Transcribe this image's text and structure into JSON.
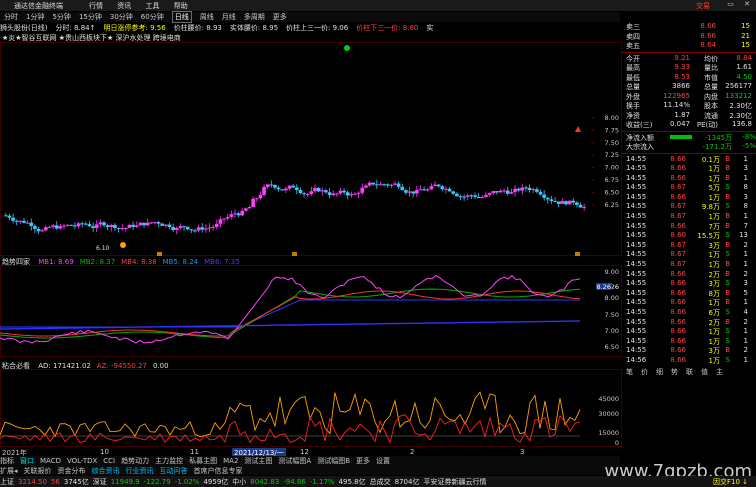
{
  "titlebar": {
    "app_name": "通达信金融终端",
    "menu": [
      "行情",
      "资讯",
      "工具",
      "帮助"
    ],
    "brand": "交易",
    "window_controls": "▭ ✕"
  },
  "periodbar": {
    "items": [
      "分时",
      "1分钟",
      "5分钟",
      "15分钟",
      "30分钟",
      "60分钟",
      "日线",
      "周线",
      "月线",
      "多周期",
      "更多"
    ],
    "active": "日线"
  },
  "infoline": {
    "items": [
      {
        "text": "狮头股份(日线)",
        "color": "#e0e0e0"
      },
      {
        "text": "分时: 8.84↑",
        "color": "#e0e0e0"
      },
      {
        "text": "明日涨停参考: 9.56",
        "color": "#ffff00"
      },
      {
        "text": "价柱腰价: 8.93",
        "color": "#e0e0e0"
      },
      {
        "text": "实体腰价: 8.95",
        "color": "#e0e0e0"
      },
      {
        "text": "价柱上三一价: 9.06",
        "color": "#e0e0e0"
      },
      {
        "text": "价柱下三一价: 8.80",
        "color": "#ff4040"
      },
      {
        "text": "实",
        "color": "#e0e0e0"
      }
    ],
    "sub": "★炎★智谷互联网 ★贵山西板块下★ 深沪水处理 跨境电商"
  },
  "main_chart": {
    "y_ticks": [
      "8.00",
      "7.75",
      "7.50",
      "7.25",
      "7.00",
      "6.75",
      "6.50",
      "6.25"
    ],
    "low_label": "6.10",
    "up_color": "#ff3cff",
    "down_color": "#3cc8ff"
  },
  "indicator1": {
    "name": "趋势四家",
    "labels": [
      {
        "text": "MB1: 8.69",
        "color": "#ff40ff"
      },
      {
        "text": "MB2: 8.37",
        "color": "#00c000"
      },
      {
        "text": "MB4: 8.38",
        "color": "#ff4040"
      },
      {
        "text": "MB5: 8.24",
        "color": "#00a0ff"
      },
      {
        "text": "MB6: 7.35",
        "color": "#4040ff"
      }
    ],
    "y_ticks": [
      "9.00",
      "8.26",
      "8.00",
      "7.50",
      "7.00",
      "6.50"
    ],
    "marker": "8.26"
  },
  "indicator2": {
    "name": "粘合必看",
    "labels": [
      {
        "text": "AD: 171421.02",
        "color": "#e0e0e0"
      },
      {
        "text": "AZ: -94550.27",
        "color": "#ff4040"
      },
      {
        "text": "0.00",
        "color": "#e0e0e0"
      }
    ],
    "y_ticks": [
      "45000",
      "30000",
      "15000",
      "0"
    ]
  },
  "timeaxis": {
    "labels": [
      "2021年",
      "10",
      "11",
      "12",
      "2021/12/13/一",
      "2",
      "3"
    ]
  },
  "tabsbar": {
    "items": [
      "指标",
      "窗口",
      "MACD",
      "VOL-TDX",
      "CCI",
      "趋势动力",
      "主力监控",
      "私募主图",
      "MA2",
      "测试主图",
      "测试幅图A",
      "测试幅图B",
      "更多",
      "设置"
    ]
  },
  "tabsbar2": {
    "items": [
      "扩展◂",
      "关联报价",
      "资金分布",
      "综合资讯",
      "行业资讯",
      "互动问答",
      "首席户信息专家"
    ]
  },
  "quote": {
    "asks": [
      {
        "label": "卖三",
        "price": "8.66",
        "vol": "15"
      },
      {
        "label": "卖四",
        "price": "8.66",
        "vol": "21"
      },
      {
        "label": "卖五",
        "price": "8.64",
        "vol": "15"
      }
    ],
    "stats": [
      {
        "k1": "今开",
        "v1": "9.21",
        "c1": "up",
        "k2": "均价",
        "v2": "8.84",
        "c2": "up"
      },
      {
        "k1": "最高",
        "v1": "9.33",
        "c1": "up",
        "k2": "量比",
        "v2": "1.61",
        "c2": "wh"
      },
      {
        "k1": "最低",
        "v1": "8.53",
        "c1": "up",
        "k2": "市值",
        "v2": "4.50",
        "c2": "dn"
      },
      {
        "k1": "总量",
        "v1": "3866",
        "c1": "wh",
        "k2": "总量",
        "v2": "256177",
        "c2": "wh"
      },
      {
        "k1": "外盘",
        "v1": "122965",
        "c1": "up",
        "k2": "内盘",
        "v2": "133212",
        "c2": "dn"
      },
      {
        "k1": "换手",
        "v1": "11.14%",
        "c1": "wh",
        "k2": "股本",
        "v2": "2.30亿",
        "c2": "wh"
      },
      {
        "k1": "净资",
        "v1": "1.87",
        "c1": "wh",
        "k2": "流通",
        "v2": "2.30亿",
        "c2": "wh"
      },
      {
        "k1": "收益(三)",
        "v1": "0.047",
        "c1": "wh",
        "k2": "PE(动)",
        "v2": "136.8",
        "c2": "wh"
      }
    ],
    "netflow": [
      {
        "label": "净流入额",
        "value": "-1345万",
        "pct": "-8%"
      },
      {
        "label": "大宗流入",
        "value": "-171.2万",
        "pct": "-5%"
      }
    ],
    "ticks": [
      {
        "t": "14:55",
        "p": "8.66",
        "v": "0.1万",
        "s": "B",
        "n": "1"
      },
      {
        "t": "14:55",
        "p": "8.66",
        "v": "1万",
        "s": "B",
        "n": "3"
      },
      {
        "t": "14:55",
        "p": "8.66",
        "v": "1万",
        "s": "B",
        "n": "1"
      },
      {
        "t": "14:55",
        "p": "8.67",
        "v": "5万",
        "s": "S",
        "n": "8"
      },
      {
        "t": "14:55",
        "p": "8.66",
        "v": "1万",
        "s": "B",
        "n": "3"
      },
      {
        "t": "14:55",
        "p": "8.67",
        "v": "9.8万",
        "s": "S",
        "n": "8"
      },
      {
        "t": "14:55",
        "p": "8.67",
        "v": "1万",
        "s": "B",
        "n": "1"
      },
      {
        "t": "14:55",
        "p": "8.66",
        "v": "7万",
        "s": "B",
        "n": "7"
      },
      {
        "t": "14:55",
        "p": "8.60",
        "v": "15.5万",
        "s": "S",
        "n": "13"
      },
      {
        "t": "14:55",
        "p": "8.67",
        "v": "3万",
        "s": "B",
        "n": "2"
      },
      {
        "t": "14:55",
        "p": "8.67",
        "v": "1万",
        "s": "S",
        "n": "1"
      },
      {
        "t": "14:55",
        "p": "8.67",
        "v": "1万",
        "s": "B",
        "n": "1"
      },
      {
        "t": "14:55",
        "p": "8.66",
        "v": "2万",
        "s": "B",
        "n": "2"
      },
      {
        "t": "14:55",
        "p": "8.66",
        "v": "3万",
        "s": "S",
        "n": "3"
      },
      {
        "t": "14:55",
        "p": "8.66",
        "v": "8万",
        "s": "B",
        "n": "5"
      },
      {
        "t": "14:55",
        "p": "8.66",
        "v": "1万",
        "s": "B",
        "n": "1"
      },
      {
        "t": "14:55",
        "p": "8.66",
        "v": "6万",
        "s": "S",
        "n": "4"
      },
      {
        "t": "14:55",
        "p": "8.66",
        "v": "2万",
        "s": "B",
        "n": "2"
      },
      {
        "t": "14:55",
        "p": "8.66",
        "v": "1万",
        "s": "S",
        "n": "1"
      },
      {
        "t": "14:55",
        "p": "8.66",
        "v": "1万",
        "s": "S",
        "n": "1"
      },
      {
        "t": "14:55",
        "p": "8.66",
        "v": "3万",
        "s": "B",
        "n": "2"
      },
      {
        "t": "14:56",
        "p": "8.66",
        "v": "1万",
        "s": "S",
        "n": "1"
      }
    ],
    "bottom_tabs": [
      "笔",
      "价",
      "细",
      "势",
      "联",
      "值",
      "主"
    ]
  },
  "statusbar": {
    "items": [
      {
        "text": "上证",
        "color": "#e0e0e0"
      },
      {
        "text": "3214.50",
        "color": "#ff4040"
      },
      {
        "text": "56",
        "color": "#ff4040"
      },
      {
        "text": "3745亿",
        "color": "#e0e0e0"
      },
      {
        "text": "深证",
        "color": "#e0e0e0"
      },
      {
        "text": "11949.9",
        "color": "#00d000"
      },
      {
        "text": "-122.79",
        "color": "#00d000"
      },
      {
        "text": "-1.02%",
        "color": "#00d000"
      },
      {
        "text": "4959亿",
        "color": "#e0e0e0"
      },
      {
        "text": "中小",
        "color": "#e0e0e0"
      },
      {
        "text": "8042.83",
        "color": "#00d000"
      },
      {
        "text": "-94.86",
        "color": "#00d000"
      },
      {
        "text": "-1.17%",
        "color": "#00d000"
      },
      {
        "text": "495.8亿",
        "color": "#e0e0e0"
      },
      {
        "text": "总成交",
        "color": "#e0e0e0"
      },
      {
        "text": "8704亿",
        "color": "#e0e0e0"
      },
      {
        "text": "平安证券新疆云行情",
        "color": "#e0e0e0"
      }
    ],
    "right_note": "因交F10 ↓"
  },
  "watermark": "www.7gpzb.com"
}
